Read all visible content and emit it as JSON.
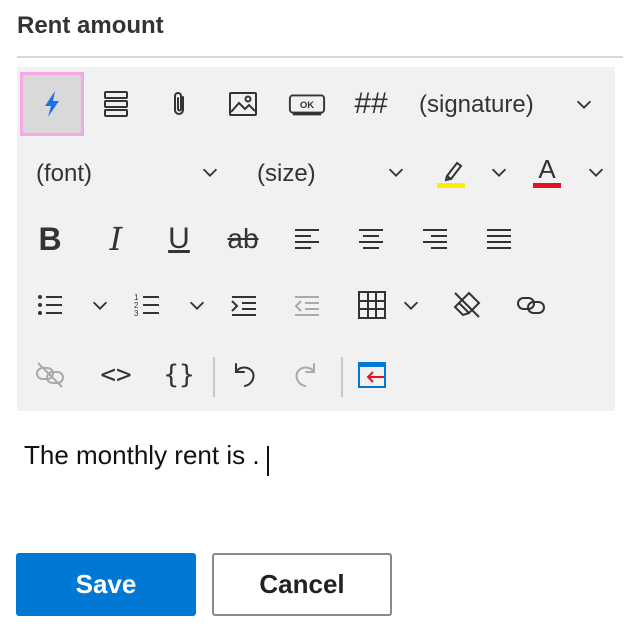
{
  "title": "Rent amount",
  "toolbar": {
    "signature_label": "(signature)",
    "font_label": "(font)",
    "size_label": "(size)",
    "hash_label": "##",
    "ok_label": "OK",
    "bold_label": "B",
    "italic_label": "I",
    "underline_label": "U",
    "strike_label": "ab",
    "font_color_label": "A",
    "code_label": "<>",
    "braces_label": "{}",
    "highlight_color": "#ffee00",
    "font_color": "#e81123"
  },
  "editor": {
    "text": "The monthly rent is ."
  },
  "buttons": {
    "save": "Save",
    "cancel": "Cancel"
  },
  "colors": {
    "accent": "#0078d4",
    "active_border": "#f5a8e6"
  }
}
